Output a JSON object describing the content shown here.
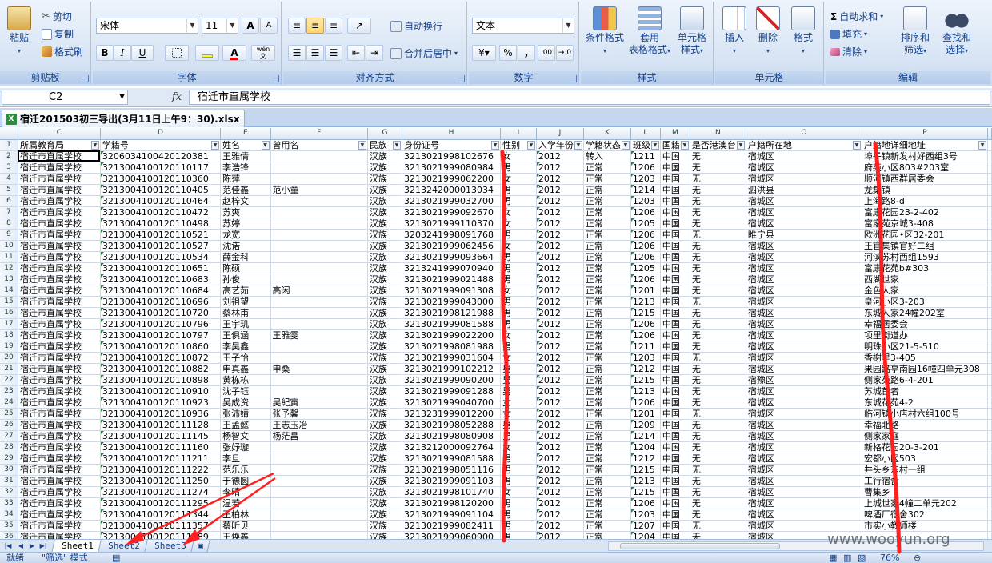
{
  "ribbon": {
    "clipboard": {
      "paste": "粘贴",
      "cut": "剪切",
      "copy": "复制",
      "format_painter": "格式刷",
      "label": "剪贴板"
    },
    "font": {
      "name": "宋体",
      "size": "11",
      "bold": "B",
      "italic": "I",
      "underline": "U",
      "grow": "A",
      "shrink": "A",
      "label": "字体",
      "pinyin": "wén"
    },
    "alignment": {
      "wrap": "自动换行",
      "merge": "合并后居中",
      "label": "对齐方式"
    },
    "number": {
      "format": "文本",
      "percent": "%",
      "comma": ",",
      "inc": ".00",
      "dec": "→.0",
      "label": "数字"
    },
    "styles": {
      "conditional": "条件格式",
      "table_fmt_1": "套用",
      "table_fmt_2": "表格格式",
      "cell_style_1": "单元格",
      "cell_style_2": "样式",
      "label": "样式"
    },
    "cells": {
      "insert": "插入",
      "delete": "删除",
      "format": "格式",
      "label": "单元格"
    },
    "editing": {
      "autosum": "自动求和",
      "fill": "填充",
      "clear": "清除",
      "sort_1": "排序和",
      "sort_2": "筛选",
      "find_1": "查找和",
      "find_2": "选择",
      "label": "编辑"
    }
  },
  "formula_bar": {
    "name_box": "C2",
    "fx": "fx",
    "content": "宿迁市直属学校"
  },
  "workbook_tab": {
    "title": "宿迁201503初三导出(3月11日上午9：30).xlsx",
    "icon": "X"
  },
  "columns": [
    "C",
    "D",
    "E",
    "F",
    "G",
    "H",
    "I",
    "J",
    "K",
    "L",
    "M",
    "N",
    "O",
    "P"
  ],
  "headers": [
    "所属教育局",
    "学籍号",
    "姓名",
    "曾用名",
    "民族",
    "身份证号",
    "性别",
    "入学年份",
    "学籍状态",
    "班级",
    "国籍",
    "是否港澳台",
    "户籍所在地",
    "户籍地详细地址"
  ],
  "rows": [
    {
      "n": "2",
      "c": [
        "宿迁市直属学校",
        "3206034100420120381",
        "王雅倩",
        "",
        "汉族",
        "3213021998102676",
        "女",
        "2012",
        "转入",
        "1211",
        "中国",
        "无",
        "宿城区",
        "埠子镇新发村好西组3号"
      ]
    },
    {
      "n": "3",
      "c": [
        "宿迁市直属学校",
        "3213004100120110117",
        "李浩锋",
        "",
        "汉族",
        "3213021999080984",
        "男",
        "2012",
        "正常",
        "1206",
        "中国",
        "无",
        "宿城区",
        "府苑小区803#203室"
      ]
    },
    {
      "n": "4",
      "c": [
        "宿迁市直属学校",
        "3213004100120110360",
        "陈萍",
        "",
        "汉族",
        "3213021999062200",
        "女",
        "2012",
        "正常",
        "1203",
        "中国",
        "无",
        "宿城区",
        "顺河镇西群居委会"
      ]
    },
    {
      "n": "5",
      "c": [
        "宿迁市直属学校",
        "3213004100120110405",
        "范佳鑫",
        "范小童",
        "汉族",
        "3213242000013034",
        "男",
        "2012",
        "正常",
        "1214",
        "中国",
        "无",
        "泗洪县",
        "龙集镇"
      ]
    },
    {
      "n": "6",
      "c": [
        "宿迁市直属学校",
        "3213004100120110464",
        "赵梓文",
        "",
        "汉族",
        "3213021999032700",
        "男",
        "2012",
        "正常",
        "1203",
        "中国",
        "无",
        "宿城区",
        "上海路8-d"
      ]
    },
    {
      "n": "7",
      "c": [
        "宿迁市直属学校",
        "3213004100120110472",
        "苏爽",
        "",
        "汉族",
        "3213021999092670",
        "女",
        "2012",
        "正常",
        "1206",
        "中国",
        "无",
        "宿城区",
        "富康花园23-2-402"
      ]
    },
    {
      "n": "8",
      "c": [
        "宿迁市直属学校",
        "3213004100120110498",
        "苏婷",
        "",
        "汉族",
        "3213021999110370",
        "女",
        "2012",
        "正常",
        "1205",
        "中国",
        "无",
        "宿城区",
        "富家苑京城3-408"
      ]
    },
    {
      "n": "9",
      "c": [
        "宿迁市直属学校",
        "3213004100120110521",
        "龙宽",
        "",
        "汉族",
        "3203241998091768",
        "男",
        "2012",
        "正常",
        "1206",
        "中国",
        "无",
        "睢宁县",
        "欧洲花园•区32-201"
      ]
    },
    {
      "n": "10",
      "c": [
        "宿迁市直属学校",
        "3213004100120110527",
        "沈诺",
        "",
        "汉族",
        "3213021999062456",
        "女",
        "2012",
        "正常",
        "1206",
        "中国",
        "无",
        "宿城区",
        "王官集镇官好二组"
      ]
    },
    {
      "n": "11",
      "c": [
        "宿迁市直属学校",
        "3213004100120110534",
        "薛金科",
        "",
        "汉族",
        "3213021999093664",
        "男",
        "2012",
        "正常",
        "1206",
        "中国",
        "无",
        "宿城区",
        "河滨苏村西组1593"
      ]
    },
    {
      "n": "12",
      "c": [
        "宿迁市直属学校",
        "3213004100120110651",
        "陈硕",
        "",
        "汉族",
        "3213241999070940",
        "男",
        "2012",
        "正常",
        "1205",
        "中国",
        "无",
        "宿城区",
        "富康花苑b#303"
      ]
    },
    {
      "n": "13",
      "c": [
        "宿迁市直属学校",
        "3213004100120110683",
        "孙俊",
        "",
        "汉族",
        "3213021999021488",
        "男",
        "2012",
        "正常",
        "1206",
        "中国",
        "无",
        "宿城区",
        "西湖世家"
      ]
    },
    {
      "n": "14",
      "c": [
        "宿迁市直属学校",
        "3213004100120110684",
        "高艺茹",
        "高闲",
        "汉族",
        "3213021999091308",
        "女",
        "2012",
        "正常",
        "1201",
        "中国",
        "无",
        "宿城区",
        "金色人家"
      ]
    },
    {
      "n": "15",
      "c": [
        "宿迁市直属学校",
        "3213004100120110696",
        "刘祖望",
        "",
        "汉族",
        "3213021999043000",
        "男",
        "2012",
        "正常",
        "1213",
        "中国",
        "无",
        "宿城区",
        "皇河小区3-203"
      ]
    },
    {
      "n": "16",
      "c": [
        "宿迁市直属学校",
        "3213004100120110720",
        "蔡林甫",
        "",
        "汉族",
        "3213021998121988",
        "男",
        "2012",
        "正常",
        "1215",
        "中国",
        "无",
        "宿城区",
        "东城人家24幢202室"
      ]
    },
    {
      "n": "17",
      "c": [
        "宿迁市直属学校",
        "3213004100120110796",
        "王宇玑",
        "",
        "汉族",
        "3213021999081588",
        "男",
        "2012",
        "正常",
        "1206",
        "中国",
        "无",
        "宿城区",
        "幸福居委会"
      ]
    },
    {
      "n": "18",
      "c": [
        "宿迁市直属学校",
        "3213004100120110797",
        "王俱涵",
        "王雅雯",
        "汉族",
        "3213021999022200",
        "女",
        "2012",
        "正常",
        "1206",
        "中国",
        "无",
        "宿城区",
        "项里街道办"
      ]
    },
    {
      "n": "19",
      "c": [
        "宿迁市直属学校",
        "3213004100120110860",
        "李昊鑫",
        "",
        "汉族",
        "3213021998081988",
        "男",
        "2012",
        "正常",
        "1211",
        "中国",
        "无",
        "宿城区",
        "明珠小区21-5-510"
      ]
    },
    {
      "n": "20",
      "c": [
        "宿迁市直属学校",
        "3213004100120110872",
        "王子怡",
        "",
        "汉族",
        "3213021999031604",
        "女",
        "2012",
        "正常",
        "1203",
        "中国",
        "无",
        "宿城区",
        "香榭里3-405"
      ]
    },
    {
      "n": "21",
      "c": [
        "宿迁市直属学校",
        "3213004100120110882",
        "申真鑫",
        "申桑",
        "汉族",
        "3213021999102212",
        "男",
        "2012",
        "正常",
        "1212",
        "中国",
        "无",
        "宿城区",
        "果园路亭南园16幢四单元308"
      ]
    },
    {
      "n": "22",
      "c": [
        "宿迁市直属学校",
        "3213004100120110898",
        "黄栋栋",
        "",
        "汉族",
        "3213021999090200",
        "男",
        "2012",
        "正常",
        "1215",
        "中国",
        "无",
        "宿豫区",
        "侧家苑路6-4-201"
      ]
    },
    {
      "n": "23",
      "c": [
        "宿迁市直属学校",
        "3213004100120110910",
        "沈子钰",
        "",
        "汉族",
        "3213021999091288",
        "男",
        "2012",
        "正常",
        "1213",
        "中国",
        "无",
        "宿城区",
        "苏城首者"
      ]
    },
    {
      "n": "24",
      "c": [
        "宿迁市直属学校",
        "3213004100120110923",
        "吴成资",
        "吴紀寅",
        "汉族",
        "3213021999040700",
        "女",
        "2012",
        "正常",
        "1206",
        "中国",
        "无",
        "宿城区",
        "东城花苑4-2"
      ]
    },
    {
      "n": "25",
      "c": [
        "宿迁市直属学校",
        "3213004100120110936",
        "张沛婧",
        "张予馨",
        "汉族",
        "3213231999012200",
        "女",
        "2012",
        "正常",
        "1201",
        "中国",
        "无",
        "宿城区",
        "临河镇小店村六组100号"
      ]
    },
    {
      "n": "26",
      "c": [
        "宿迁市直属学校",
        "3213004100120111128",
        "王孟懿",
        "王志玉冶",
        "汉族",
        "3213021998052288",
        "男",
        "2012",
        "正常",
        "1209",
        "中国",
        "无",
        "宿城区",
        "幸福北路"
      ]
    },
    {
      "n": "27",
      "c": [
        "宿迁市直属学校",
        "3213004100120111145",
        "杨智文",
        "杨茫昌",
        "汉族",
        "3213021998080908",
        "男",
        "2012",
        "正常",
        "1214",
        "中国",
        "无",
        "宿城区",
        "侧家家庭"
      ]
    },
    {
      "n": "28",
      "c": [
        "宿迁市直属学校",
        "3213004100120111160",
        "张妤璇",
        "",
        "汉族",
        "3213212000092764",
        "女",
        "2012",
        "正常",
        "1204",
        "中国",
        "无",
        "宿城区",
        "新格花园20-3-201"
      ]
    },
    {
      "n": "29",
      "c": [
        "宿迁市直属学校",
        "3213004100120111211",
        "李旦",
        "",
        "汉族",
        "3213021999081588",
        "男",
        "2012",
        "正常",
        "1212",
        "中国",
        "无",
        "宿城区",
        "宏都小区503"
      ]
    },
    {
      "n": "30",
      "c": [
        "宿迁市直属学校",
        "3213004100120111222",
        "范乐乐",
        "",
        "汉族",
        "3213021998051116",
        "男",
        "2012",
        "正常",
        "1215",
        "中国",
        "无",
        "宿城区",
        "井头乡东村一组"
      ]
    },
    {
      "n": "31",
      "c": [
        "宿迁市直属学校",
        "3213004100120111250",
        "于德圆",
        "",
        "汉族",
        "3213021999091103",
        "男",
        "2012",
        "正常",
        "1213",
        "中国",
        "无",
        "宿城区",
        "工行宿舍"
      ]
    },
    {
      "n": "32",
      "c": [
        "宿迁市直属学校",
        "3213004100120111274",
        "李晴",
        "",
        "汉族",
        "3213021998101740",
        "女",
        "2012",
        "正常",
        "1215",
        "中国",
        "无",
        "宿城区",
        "曹集乡"
      ]
    },
    {
      "n": "33",
      "c": [
        "宿迁市直属学校",
        "3213004100120111295",
        "温若",
        "",
        "汉族",
        "3213021998120200",
        "男",
        "2012",
        "正常",
        "1206",
        "中国",
        "无",
        "宿城区",
        "上城世家4幢二单元202"
      ]
    },
    {
      "n": "34",
      "c": [
        "宿迁市直属学校",
        "3213004100120111344",
        "王柏林",
        "",
        "汉族",
        "3213021999091104",
        "男",
        "2012",
        "正常",
        "1203",
        "中国",
        "无",
        "宿城区",
        "啤酒厂宿舍302"
      ]
    },
    {
      "n": "35",
      "c": [
        "宿迁市直属学校",
        "3213004100120111357",
        "蔡昕贝",
        "",
        "汉族",
        "3213021999082411",
        "男",
        "2012",
        "正常",
        "1207",
        "中国",
        "无",
        "宿城区",
        "市实小教师楼"
      ]
    },
    {
      "n": "36",
      "c": [
        "宿迁市直属学校",
        "3213004100120111389",
        "王焕鑫",
        "",
        "汉族",
        "3213021999060900",
        "男",
        "2012",
        "正常",
        "1204",
        "中国",
        "无",
        "宿城区",
        ""
      ]
    }
  ],
  "sheet_tabs": [
    "Sheet1",
    "Sheet2",
    "Sheet3"
  ],
  "status": {
    "ready": "就绪",
    "mode": "\"筛选\" 模式",
    "zoom": "76%"
  },
  "watermark": "www.wooyun.org",
  "colors": {
    "accent": "#15428b",
    "annotation": "#ff2020",
    "ribbon": "#d7e4f4"
  }
}
